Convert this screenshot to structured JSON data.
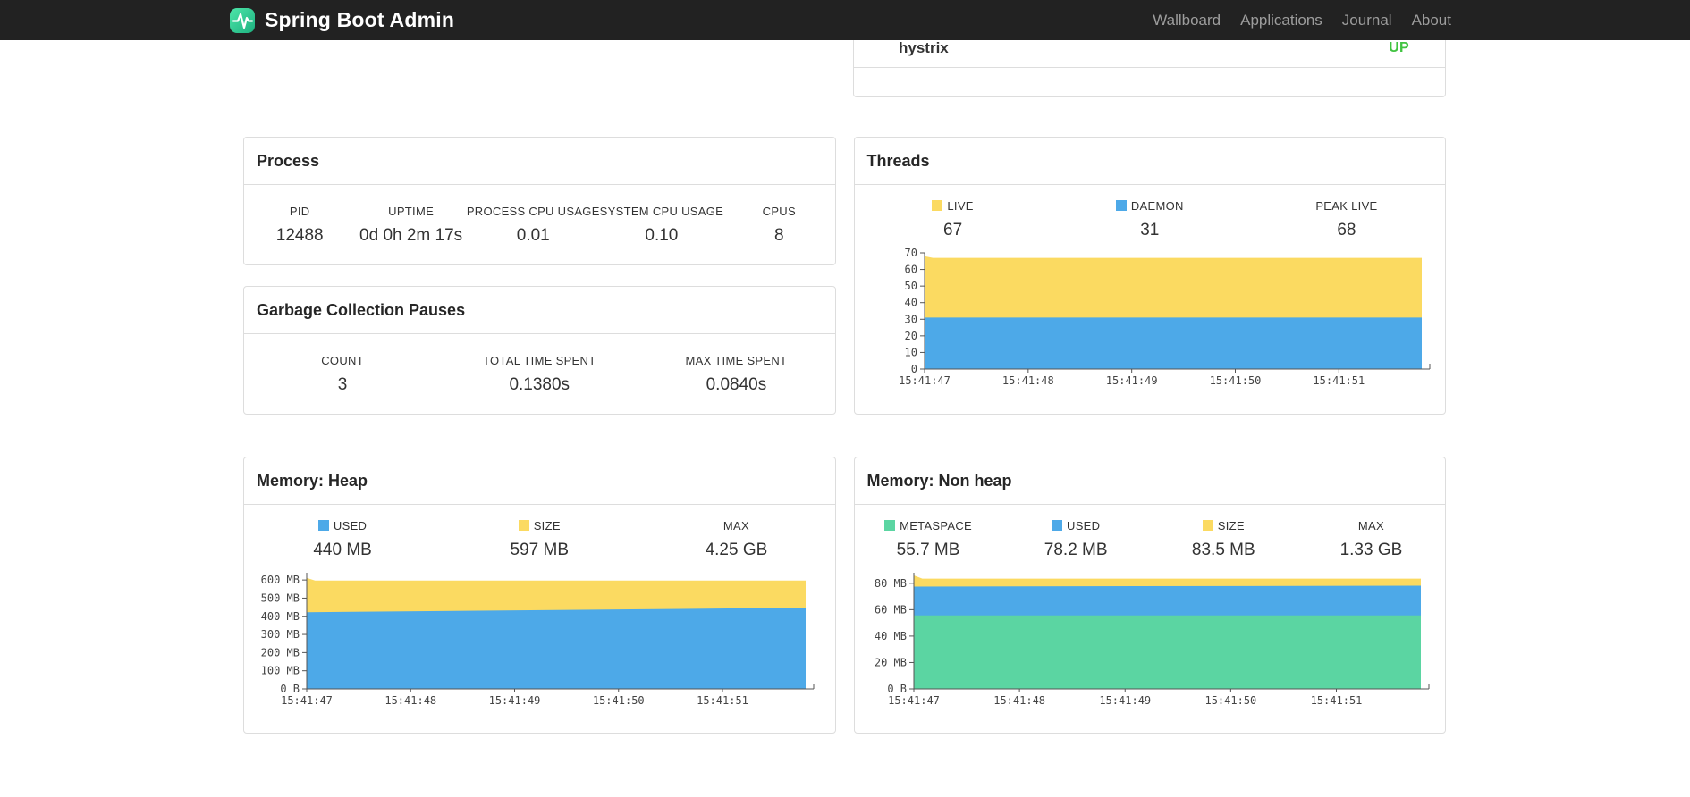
{
  "navbar": {
    "brand": "Spring Boot Admin",
    "links": [
      "Wallboard",
      "Applications",
      "Journal",
      "About"
    ]
  },
  "applications": {
    "rows": [
      {
        "name": "hystrix",
        "status": "UP",
        "status_color": "#41c341"
      }
    ]
  },
  "panels": {
    "process": {
      "title": "Process",
      "stats": [
        {
          "label": "PID",
          "value": "12488"
        },
        {
          "label": "UPTIME",
          "value": "0d 0h 2m 17s"
        },
        {
          "label": "PROCESS CPU USAGE",
          "value": "0.01"
        },
        {
          "label": "SYSTEM CPU USAGE",
          "value": "0.10"
        },
        {
          "label": "CPUS",
          "value": "8"
        }
      ]
    },
    "gc": {
      "title": "Garbage Collection Pauses",
      "stats": [
        {
          "label": "COUNT",
          "value": "3"
        },
        {
          "label": "TOTAL TIME SPENT",
          "value": "0.1380s"
        },
        {
          "label": "MAX TIME SPENT",
          "value": "0.0840s"
        }
      ]
    },
    "threads": {
      "title": "Threads",
      "stats": [
        {
          "label": "LIVE",
          "value": "67",
          "color": "#fbda61"
        },
        {
          "label": "DAEMON",
          "value": "31",
          "color": "#4da9e8"
        },
        {
          "label": "PEAK LIVE",
          "value": "68"
        }
      ]
    },
    "heap": {
      "title": "Memory: Heap",
      "stats": [
        {
          "label": "USED",
          "value": "440 MB",
          "color": "#4da9e8"
        },
        {
          "label": "SIZE",
          "value": "597 MB",
          "color": "#fbda61"
        },
        {
          "label": "MAX",
          "value": "4.25 GB"
        }
      ]
    },
    "nonheap": {
      "title": "Memory: Non heap",
      "stats": [
        {
          "label": "METASPACE",
          "value": "55.7 MB",
          "color": "#5bd5a2"
        },
        {
          "label": "USED",
          "value": "78.2 MB",
          "color": "#4da9e8"
        },
        {
          "label": "SIZE",
          "value": "83.5 MB",
          "color": "#fbda61"
        },
        {
          "label": "MAX",
          "value": "1.33 GB"
        }
      ]
    }
  },
  "chart_data": [
    {
      "id": "threads",
      "type": "area",
      "x_tick_labels": [
        "15:41:47",
        "15:41:48",
        "15:41:49",
        "15:41:50",
        "15:41:51"
      ],
      "x_tick_positions": [
        0,
        1,
        2,
        3,
        4
      ],
      "xlim": [
        0,
        4.8
      ],
      "y_tick_labels": [
        "0",
        "10",
        "20",
        "30",
        "40",
        "50",
        "60",
        "70"
      ],
      "y_tick_values": [
        0,
        10,
        20,
        30,
        40,
        50,
        60,
        70
      ],
      "ylim": [
        0,
        70
      ],
      "series": [
        {
          "name": "LIVE",
          "color": "#fbda61",
          "points": [
            [
              0,
              68
            ],
            [
              0.08,
              67
            ],
            [
              4.8,
              67
            ]
          ]
        },
        {
          "name": "DAEMON",
          "color": "#4da9e8",
          "points": [
            [
              0,
              31
            ],
            [
              4.8,
              31
            ]
          ]
        }
      ]
    },
    {
      "id": "heap",
      "type": "area",
      "x_tick_labels": [
        "15:41:47",
        "15:41:48",
        "15:41:49",
        "15:41:50",
        "15:41:51"
      ],
      "x_tick_positions": [
        0,
        1,
        2,
        3,
        4
      ],
      "xlim": [
        0,
        4.8
      ],
      "y_tick_labels": [
        "0 B",
        "100 MB",
        "200 MB",
        "300 MB",
        "400 MB",
        "500 MB",
        "600 MB"
      ],
      "y_tick_values": [
        0,
        100,
        200,
        300,
        400,
        500,
        600
      ],
      "ylim": [
        0,
        640
      ],
      "series": [
        {
          "name": "SIZE",
          "color": "#fbda61",
          "points": [
            [
              0,
              612
            ],
            [
              0.08,
              597
            ],
            [
              4.8,
              597
            ]
          ]
        },
        {
          "name": "USED",
          "color": "#4da9e8",
          "points": [
            [
              0,
              422
            ],
            [
              4.8,
              447
            ]
          ]
        }
      ]
    },
    {
      "id": "nonheap",
      "type": "area",
      "x_tick_labels": [
        "15:41:47",
        "15:41:48",
        "15:41:49",
        "15:41:50",
        "15:41:51"
      ],
      "x_tick_positions": [
        0,
        1,
        2,
        3,
        4
      ],
      "xlim": [
        0,
        4.8
      ],
      "y_tick_labels": [
        "0 B",
        "20 MB",
        "40 MB",
        "60 MB",
        "80 MB"
      ],
      "y_tick_values": [
        0,
        20,
        40,
        60,
        80
      ],
      "ylim": [
        0,
        88
      ],
      "series": [
        {
          "name": "SIZE",
          "color": "#fbda61",
          "points": [
            [
              0,
              86
            ],
            [
              0.08,
              83.5
            ],
            [
              4.8,
              83.5
            ]
          ]
        },
        {
          "name": "USED",
          "color": "#4da9e8",
          "points": [
            [
              0,
              77.5
            ],
            [
              4.8,
              78.2
            ]
          ]
        },
        {
          "name": "METASPACE",
          "color": "#5bd5a2",
          "points": [
            [
              0,
              55.7
            ],
            [
              4.8,
              55.7
            ]
          ]
        }
      ]
    }
  ]
}
